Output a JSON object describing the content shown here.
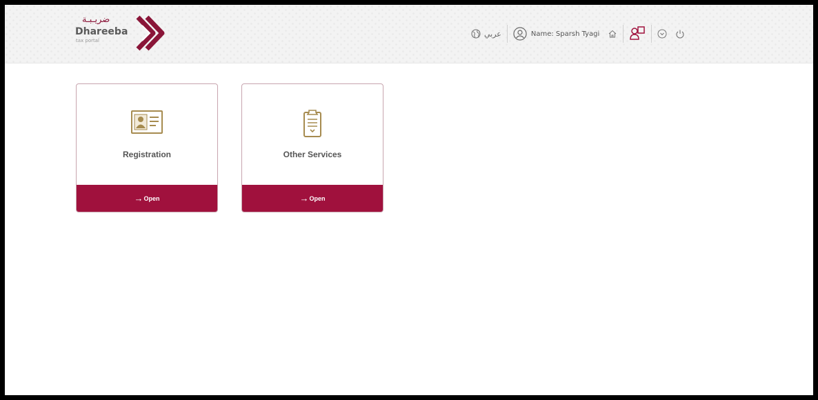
{
  "brand": {
    "arabic_name": "ضريـبـة",
    "name": "Dhareeba",
    "tagline": "tax portal"
  },
  "header": {
    "language_label": "عربي",
    "user_label": "Name: Sparsh Tyagi"
  },
  "icons": {
    "language": "globe-icon",
    "user": "user-circle-icon",
    "home": "home-icon",
    "switch_account": "switch-user-icon",
    "dropdown": "chevron-down-circle-icon",
    "logout": "power-icon"
  },
  "cards": [
    {
      "title": "Registration",
      "action_label": "Open",
      "icon": "id-card-icon"
    },
    {
      "title": "Other Services",
      "action_label": "Open",
      "icon": "clipboard-icon"
    }
  ],
  "colors": {
    "brand_primary": "#a0113d",
    "icon_gold": "#a68b4f"
  }
}
